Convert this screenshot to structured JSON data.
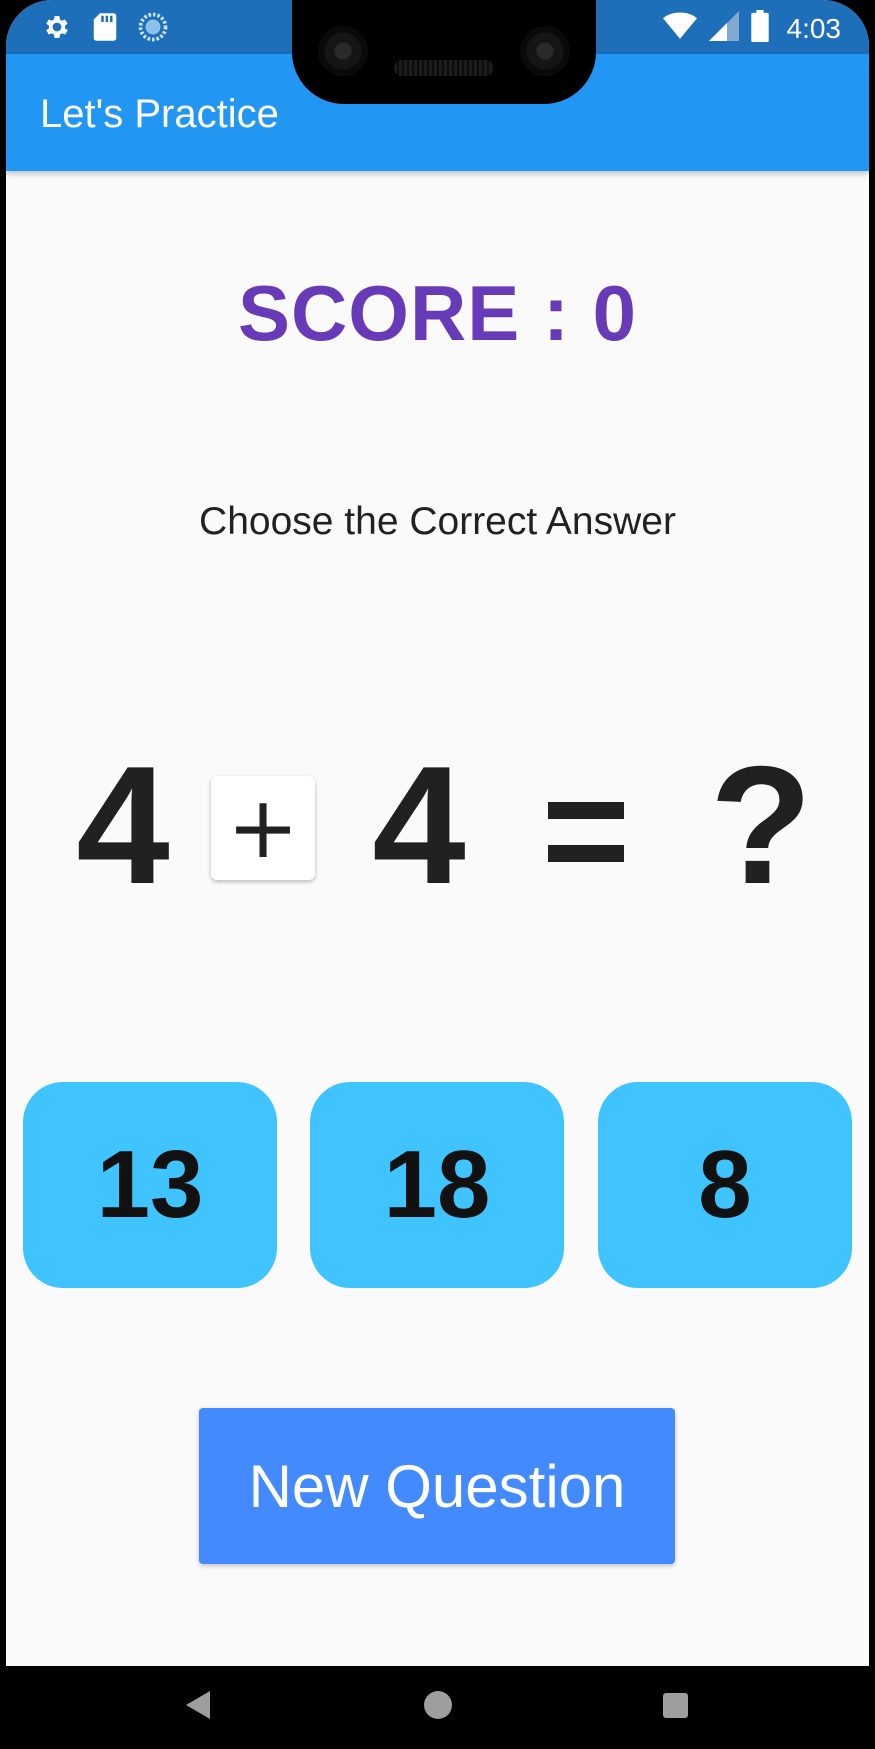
{
  "status_bar": {
    "left_icons": [
      "gear-icon",
      "sd-card-icon",
      "sync-circle-icon"
    ],
    "time": "4:03",
    "right_icons": [
      "wifi-icon",
      "signal-icon",
      "battery-icon"
    ],
    "background": "#1c6fb8"
  },
  "app_bar": {
    "title": "Let's Practice",
    "background": "#2196f3"
  },
  "score": {
    "text": "SCORE : 0",
    "color": "#673ab7"
  },
  "instruction": "Choose the Correct Answer",
  "equation": {
    "left_operand": "4",
    "operator": "+",
    "right_operand": "4",
    "equals_icon": "equals-icon",
    "unknown": "?"
  },
  "answers": [
    "13",
    "18",
    "8"
  ],
  "answer_color": "#40c4ff",
  "new_question_button": {
    "label": "New Question",
    "color": "#448aff"
  },
  "nav_bar": {
    "icons": [
      "back-icon",
      "home-icon",
      "recents-icon"
    ]
  }
}
